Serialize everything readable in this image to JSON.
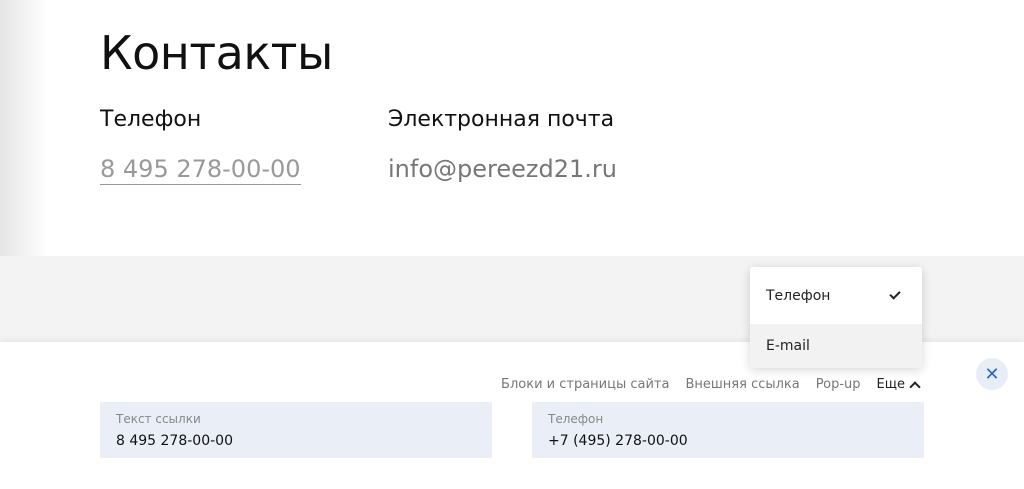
{
  "page": {
    "title": "Контакты",
    "phone": {
      "heading": "Телефон",
      "value": "8 495 278-00-00"
    },
    "email": {
      "heading": "Электронная почта",
      "value": "info@pereezd21.ru"
    }
  },
  "link_editor": {
    "types": [
      "Блоки и страницы сайта",
      "Внешняя ссылка",
      "Pop-up",
      "Еще"
    ],
    "close_icon": "close-icon",
    "text_field": {
      "label": "Текст ссылки",
      "value": "8 495 278-00-00"
    },
    "phone_field": {
      "label": "Телефон",
      "value": "+7 (495) 278-00-00"
    }
  },
  "dropdown": {
    "items": [
      {
        "label": "Телефон",
        "selected": true
      },
      {
        "label": "E-mail",
        "selected": false
      }
    ]
  },
  "colors": {
    "accent": "#2a67c8",
    "field_bg": "#e9eef7",
    "band_bg": "#f3f3f3"
  }
}
